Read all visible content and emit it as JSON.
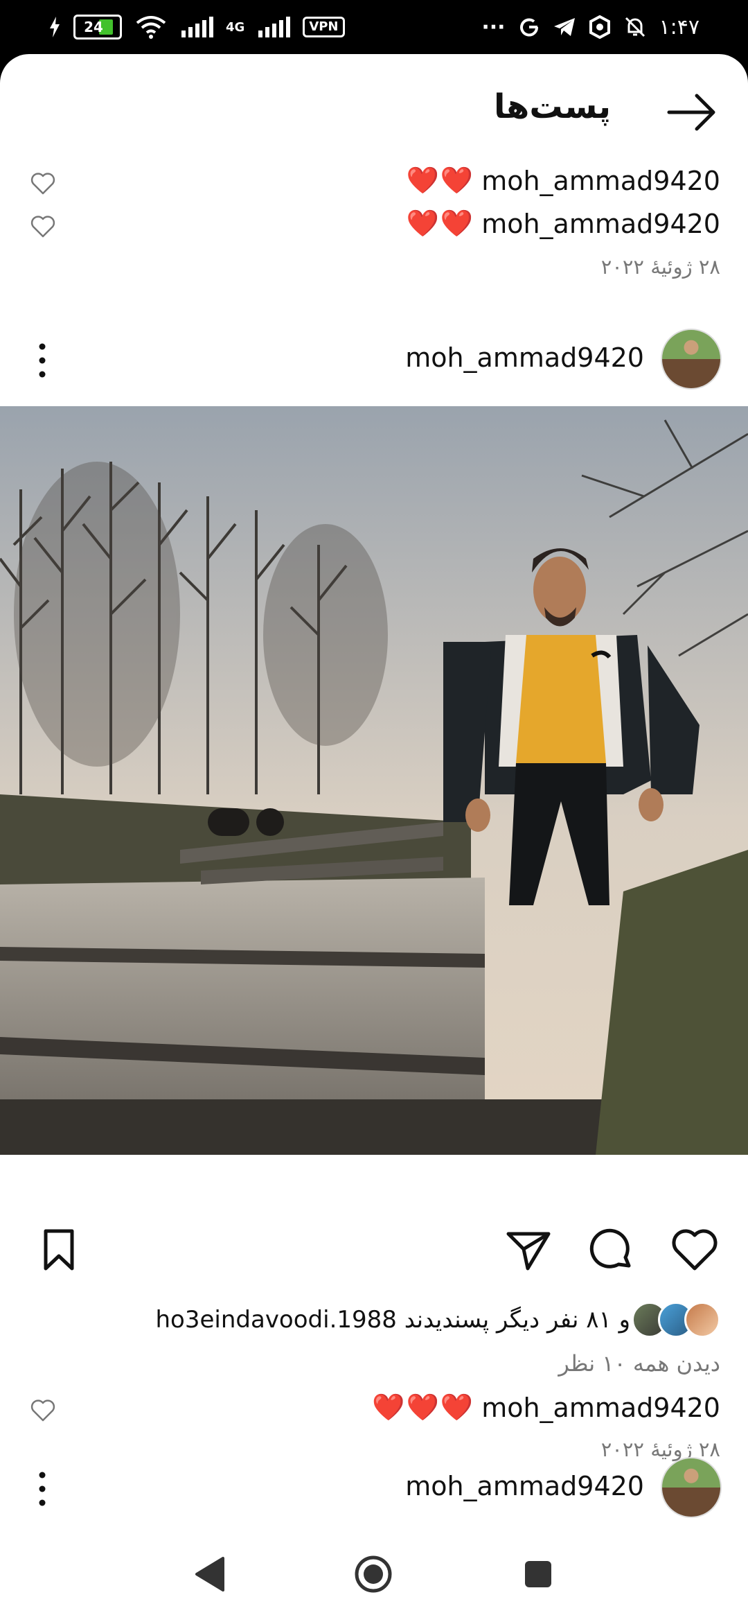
{
  "status_bar": {
    "battery_level": "24",
    "network_type": "4G",
    "vpn_label": "VPN",
    "overflow": "···",
    "time": "۱:۴۷"
  },
  "header": {
    "title": "پست‌ها"
  },
  "comments_top": [
    {
      "username": "moh_ammad9420",
      "emoji": "❤️❤️"
    },
    {
      "username": "moh_ammad9420",
      "emoji": "❤️❤️"
    }
  ],
  "date_top": "۲۸ ژوئیهٔ ۲۰۲۲",
  "post": {
    "username": "moh_ammad9420",
    "liked_by": "و ۸۱ نفر دیگر پسندیدند ho3eindavoodi.1988",
    "liked_by_user": "ho3eindavoodi.1988",
    "liked_by_rest": "و ۸۱ نفر دیگر پسندیدند",
    "view_all_comments": "دیدن همه ۱۰ نظر",
    "comment": {
      "username": "moh_ammad9420",
      "emoji": "❤️❤️❤️"
    },
    "date": "۲۸ ژوئیهٔ ۲۰۲۲"
  },
  "next_post": {
    "username": "moh_ammad9420"
  },
  "colors": {
    "accent_heart": "#e02424",
    "secondary_text": "#777777",
    "battery_fill": "#42c12c"
  },
  "icons": {
    "back": "arrow-right-icon",
    "heart": "heart-icon",
    "comment": "comment-icon",
    "share": "send-icon",
    "save": "bookmark-icon",
    "more": "more-vertical-icon"
  }
}
